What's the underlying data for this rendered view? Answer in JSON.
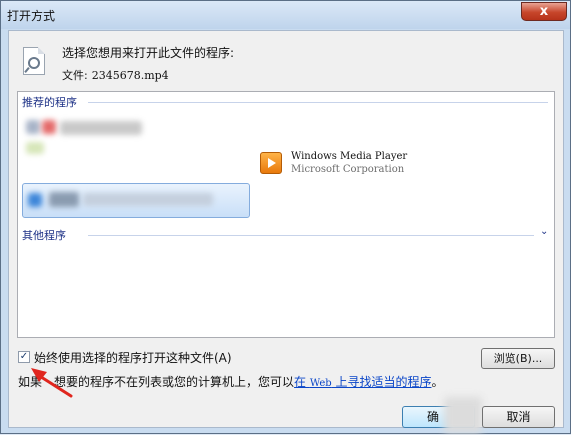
{
  "window": {
    "title": "打开方式",
    "close_label": "x"
  },
  "header": {
    "prompt": "选择您想用来打开此文件的程序:",
    "file_label": "文件:",
    "file_name": "2345678.mp4"
  },
  "list": {
    "recommended_label": "推荐的程序",
    "other_label": "其他程序",
    "programs": [
      {
        "name": "Windows Media Player",
        "publisher": "Microsoft Corporation",
        "icon": "windows-media-player-icon"
      }
    ],
    "expand_icon": "chevron-down-icon",
    "expand_glyph": "⌄"
  },
  "footer": {
    "always_use_label": "始终使用选择的程序打开这种文件(A)",
    "always_use_checked": true,
    "check_glyph": "✓",
    "browse_label": "浏览(B)...",
    "info_prefix": "如果",
    "info_middle": "想要的程序不在列表或您的计算机上，您可以",
    "info_link_pre": "在 ",
    "info_link_web": "Web",
    "info_link_post": " 上寻找适当的程序",
    "info_suffix": "。",
    "ok_label": "确",
    "cancel_label": "取消"
  },
  "colors": {
    "accent": "#1e3287",
    "link": "#0b46c8",
    "annotation_arrow": "#e0261e"
  }
}
